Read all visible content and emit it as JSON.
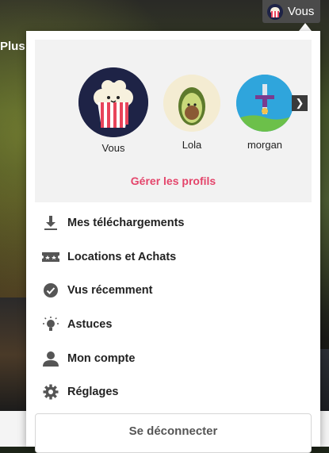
{
  "background": {
    "partial_title": "Plus"
  },
  "account": {
    "label": "Vous",
    "avatar_icon": "popcorn-avatar-icon"
  },
  "profiles": {
    "items": [
      {
        "name": "Vous",
        "avatar": "popcorn-avatar-icon"
      },
      {
        "name": "Lola",
        "avatar": "avocado-avatar-icon"
      },
      {
        "name": "morgan",
        "avatar": "sword-avatar-icon"
      }
    ],
    "next_icon": "chevron-right-icon",
    "manage_label": "Gérer les profils",
    "manage_color": "#e4456b"
  },
  "menu": {
    "items": [
      {
        "label": "Mes téléchargements",
        "icon": "download-icon"
      },
      {
        "label": "Locations et Achats",
        "icon": "ticket-icon"
      },
      {
        "label": "Vus récemment",
        "icon": "check-circle-icon"
      },
      {
        "label": "Astuces",
        "icon": "lightbulb-icon"
      },
      {
        "label": "Mon compte",
        "icon": "user-icon"
      },
      {
        "label": "Réglages",
        "icon": "gear-icon"
      }
    ]
  },
  "logout_label": "Se déconnecter"
}
